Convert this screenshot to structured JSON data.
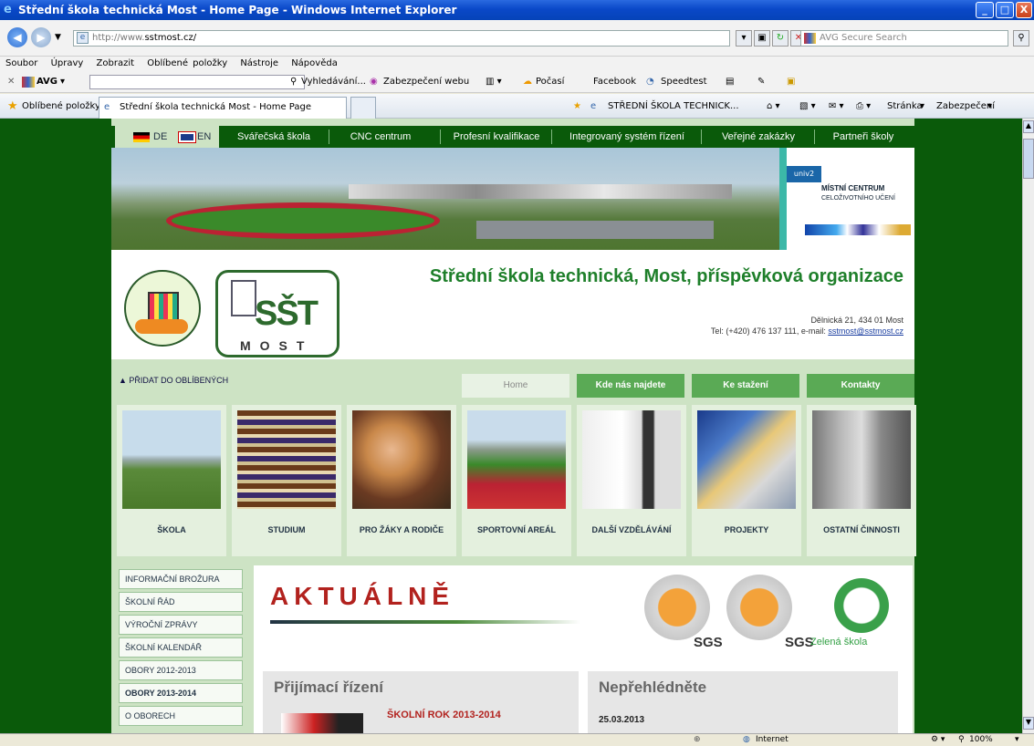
{
  "window": {
    "title": "Střední škola technická Most - Home Page - Windows Internet Explorer",
    "buttons": [
      "_",
      "□",
      "X"
    ]
  },
  "address": {
    "url_prefix": "http://www.",
    "url_domain": "sstmost.cz/",
    "search_placeholder": "AVG Secure Search"
  },
  "menu": [
    "Soubor",
    "Úpravy",
    "Zobrazit",
    "Oblíbené položky",
    "Nástroje",
    "Nápověda"
  ],
  "toolbar": {
    "avg_label": "AVG",
    "search_label": "Vyhledávání...",
    "security_label": "Zabezpečení webu",
    "weather_label": "Počasí",
    "facebook_label": "Facebook",
    "speedtest_label": "Speedtest"
  },
  "favbar": {
    "favorites_label": "Oblíbené položky",
    "tab_title": "Střední škola technická Most - Home Page",
    "page_title_short": "STŘEDNÍ ŠKOLA TECHNICK...",
    "page_menu": "Stránka",
    "security_menu": "Zabezpečení"
  },
  "site": {
    "lang_de": "DE",
    "lang_en": "EN",
    "topnav": [
      "Svářečská škola",
      "CNC centrum",
      "Profesní kvalifikace",
      "Integrovaný systém řízení",
      "Veřejné zakázky",
      "Partneři školy"
    ],
    "mc_line1": "MÍSTNÍ CENTRUM",
    "mc_line2": "CELOŽIVOTNÍHO UČENÍ",
    "mc_logo": "univ2",
    "logo_ring": "PATEŘNÍ ŠKOLA ÚSTECKÉHO KRAJE",
    "logo_sst": "SŠT",
    "logo_most": "MOST",
    "title": "Střední škola technická, Most, příspěvková organizace",
    "address_line": "Dělnická 21, 434 01 Most",
    "tel_line": "Tel: (+420) 476 137 111, e-mail:",
    "email": "sstmost@sstmost.cz",
    "add_favorites": "▲ PŘIDAT DO OBLÍBENÝCH",
    "navtabs": [
      "Home",
      "Kde nás najdete",
      "Ke stažení",
      "Kontakty"
    ],
    "tiles": [
      "ŠKOLA",
      "STUDIUM",
      "PRO ŽÁKY A RODIČE",
      "SPORTOVNÍ AREÁL",
      "DALŠÍ VZDĚLÁVÁNÍ",
      "PROJEKTY",
      "OSTATNÍ ČINNOSTI"
    ],
    "leftmenu": [
      "INFORMAČNÍ BROŽURA",
      "ŠKOLNÍ ŘÁD",
      "VÝROČNÍ ZPRÁVY",
      "ŠKOLNÍ KALENDÁŘ",
      "OBORY 2012-2013",
      "OBORY 2013-2014",
      "O OBORECH"
    ],
    "aktualne": "AKTUÁLNĚ",
    "cert1_text": "SGS",
    "cert2_text": "SGS",
    "zelena": "Zelená škola",
    "prijimaci": "Přijímací řízení",
    "skolni_rok": "ŠKOLNÍ ROK 2013-2014",
    "neprehlednete": "Nepřehlédněte",
    "news_date": "25.03.2013"
  },
  "status": {
    "zone": "Internet",
    "zoom": "100%"
  },
  "colors": {
    "page_bg": "#0a5a0a",
    "site_bg": "#cde3c4",
    "title_green": "#1e7f2a",
    "aktualne_red": "#b2221e",
    "nav_green": "#5aaa55"
  }
}
